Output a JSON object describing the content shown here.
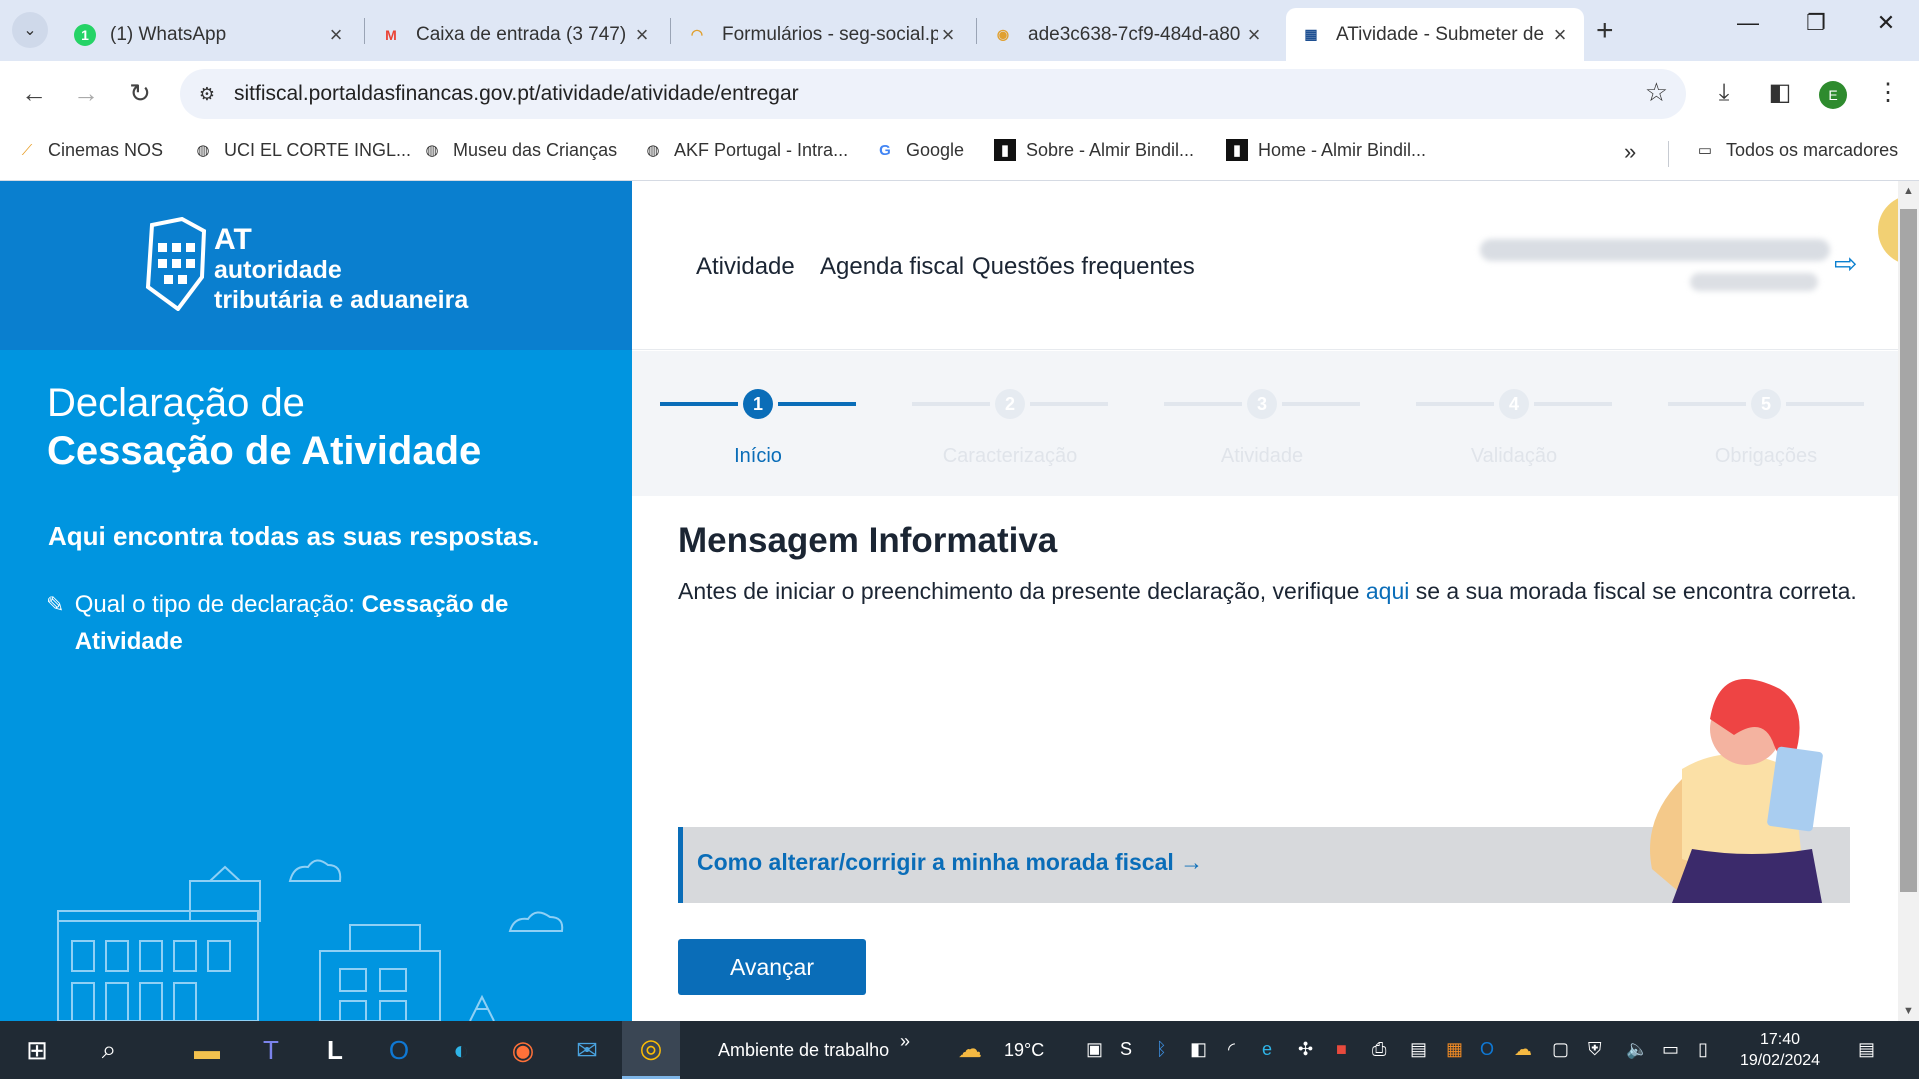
{
  "browser": {
    "tabs": [
      {
        "title": "(1) WhatsApp",
        "icon": "whatsapp-icon",
        "color": "#25d366",
        "glyph": "1"
      },
      {
        "title": "Caixa de entrada (3 747)",
        "icon": "gmail-icon",
        "color": "#ea4335",
        "glyph": "M"
      },
      {
        "title": "Formulários - seg-social.p",
        "icon": "seg-social-icon",
        "color": "#e0a030",
        "glyph": "◠"
      },
      {
        "title": "ade3c638-7cf9-484d-a80",
        "icon": "eye-icon",
        "color": "#e0a030",
        "glyph": "◉"
      },
      {
        "title": "ATividade - Submeter de",
        "icon": "at-icon",
        "color": "#1d4f91",
        "glyph": "▦"
      }
    ],
    "active_tab_index": 4,
    "url": "sitfiscal.portaldasfinancas.gov.pt/atividade/atividade/entregar",
    "profile_initial": "E",
    "bookmarks": [
      {
        "label": "Cinemas NOS",
        "icon": "nos-icon"
      },
      {
        "label": "UCI EL CORTE INGL...",
        "icon": "globe-icon"
      },
      {
        "label": "Museu das Crianças",
        "icon": "globe-icon"
      },
      {
        "label": "AKF Portugal - Intra...",
        "icon": "globe-icon"
      },
      {
        "label": "Google",
        "icon": "google-icon"
      },
      {
        "label": "Sobre - Almir Bindil...",
        "icon": "site-icon"
      },
      {
        "label": "Home - Almir Bindil...",
        "icon": "site-icon"
      }
    ],
    "all_bookmarks_label": "Todos os marcadores"
  },
  "sidebar": {
    "logo": {
      "at": "AT",
      "line1": "autoridade",
      "line2": "tributária e aduaneira"
    },
    "title_line1": "Declaração de",
    "title_line2": "Cessação de Atividade",
    "answers": "Aqui encontra todas as suas respostas.",
    "type_label": "Qual o tipo de declaração: ",
    "type_value": "Cessação de Atividade"
  },
  "topnav": {
    "links": [
      "Atividade",
      "Agenda fiscal",
      "Questões frequentes"
    ]
  },
  "stepper": {
    "steps": [
      {
        "num": "1",
        "label": "Início"
      },
      {
        "num": "2",
        "label": "Caracterização"
      },
      {
        "num": "3",
        "label": "Atividade"
      },
      {
        "num": "4",
        "label": "Validação"
      },
      {
        "num": "5",
        "label": "Obrigações"
      }
    ],
    "active_index": 0
  },
  "main": {
    "title": "Mensagem Informativa",
    "body_before": "Antes de iniciar o preenchimento da presente declaração, verifique ",
    "body_link": "aqui",
    "body_after": " se a sua morada fiscal se encontra correta.",
    "help_link": "Como alterar/corrigir a minha morada fiscal →",
    "advance_button": "Avançar"
  },
  "taskbar": {
    "desktop_label": "Ambiente de trabalho",
    "temperature": "19°C",
    "time": "17:40",
    "date": "19/02/2024"
  },
  "colors": {
    "sidebar": "#0095e0",
    "brand_dark": "#0a7fcf",
    "accent": "#0a6db8"
  }
}
